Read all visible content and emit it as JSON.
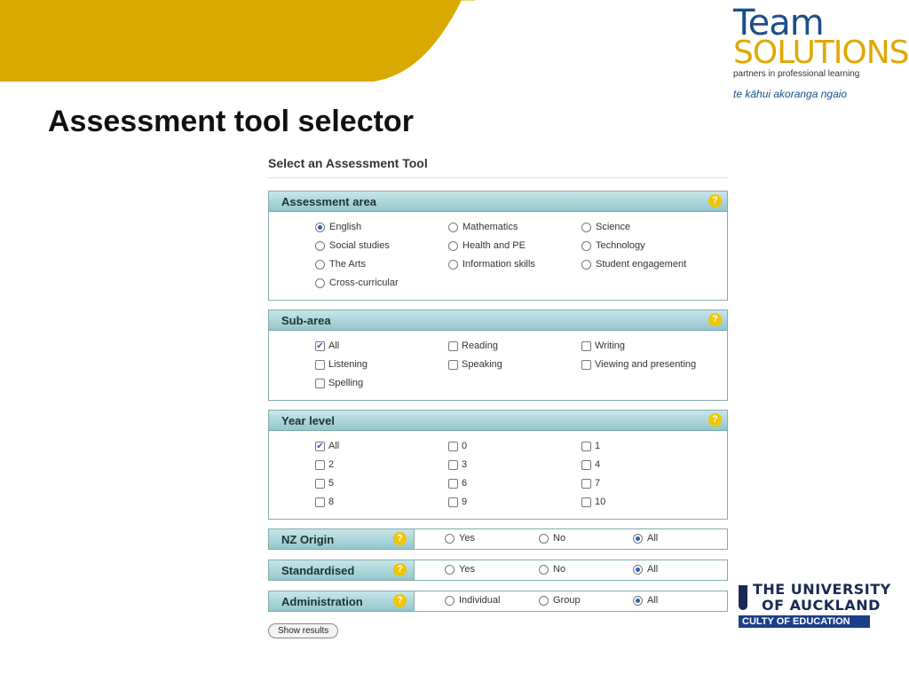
{
  "slide": {
    "title": "Assessment tool selector"
  },
  "branding": {
    "team_line1": "Team",
    "team_line2": "SOLUTIONS",
    "tagline": "partners in professional learning",
    "maori_tagline": "te kāhui akoranga ngaio",
    "university_line1": "THE UNIVERSITY",
    "university_line2": "OF AUCKLAND",
    "faculty": "CULTY OF EDUCATION"
  },
  "form": {
    "heading": "Select an Assessment Tool",
    "help_symbol": "?",
    "assessment_area": {
      "title": "Assessment area",
      "options": [
        {
          "label": "English",
          "selected": true
        },
        {
          "label": "Mathematics",
          "selected": false
        },
        {
          "label": "Science",
          "selected": false
        },
        {
          "label": "Social studies",
          "selected": false
        },
        {
          "label": "Health and PE",
          "selected": false
        },
        {
          "label": "Technology",
          "selected": false
        },
        {
          "label": "The Arts",
          "selected": false
        },
        {
          "label": "Information skills",
          "selected": false
        },
        {
          "label": "Student engagement",
          "selected": false
        },
        {
          "label": "Cross-curricular",
          "selected": false
        }
      ]
    },
    "sub_area": {
      "title": "Sub-area",
      "options": [
        {
          "label": "All",
          "checked": true
        },
        {
          "label": "Reading",
          "checked": false
        },
        {
          "label": "Writing",
          "checked": false
        },
        {
          "label": "Listening",
          "checked": false
        },
        {
          "label": "Speaking",
          "checked": false
        },
        {
          "label": "Viewing and presenting",
          "checked": false
        },
        {
          "label": "Spelling",
          "checked": false
        }
      ]
    },
    "year_level": {
      "title": "Year level",
      "options": [
        {
          "label": "All",
          "checked": true
        },
        {
          "label": "0",
          "checked": false
        },
        {
          "label": "1",
          "checked": false
        },
        {
          "label": "2",
          "checked": false
        },
        {
          "label": "3",
          "checked": false
        },
        {
          "label": "4",
          "checked": false
        },
        {
          "label": "5",
          "checked": false
        },
        {
          "label": "6",
          "checked": false
        },
        {
          "label": "7",
          "checked": false
        },
        {
          "label": "8",
          "checked": false
        },
        {
          "label": "9",
          "checked": false
        },
        {
          "label": "10",
          "checked": false
        }
      ]
    },
    "nz_origin": {
      "title": "NZ Origin",
      "options": [
        {
          "label": "Yes",
          "selected": false
        },
        {
          "label": "No",
          "selected": false
        },
        {
          "label": "All",
          "selected": true
        }
      ]
    },
    "standardised": {
      "title": "Standardised",
      "options": [
        {
          "label": "Yes",
          "selected": false
        },
        {
          "label": "No",
          "selected": false
        },
        {
          "label": "All",
          "selected": true
        }
      ]
    },
    "administration": {
      "title": "Administration",
      "options": [
        {
          "label": "Individual",
          "selected": false
        },
        {
          "label": "Group",
          "selected": false
        },
        {
          "label": "All",
          "selected": true
        }
      ]
    },
    "show_results_label": "Show results"
  },
  "colors": {
    "swoosh": "#d9a900",
    "panel_header": "#a9d6db",
    "radio_selected": "#2f5fb0",
    "brand_blue": "#1c4f8a",
    "brand_gold": "#e0a800"
  }
}
